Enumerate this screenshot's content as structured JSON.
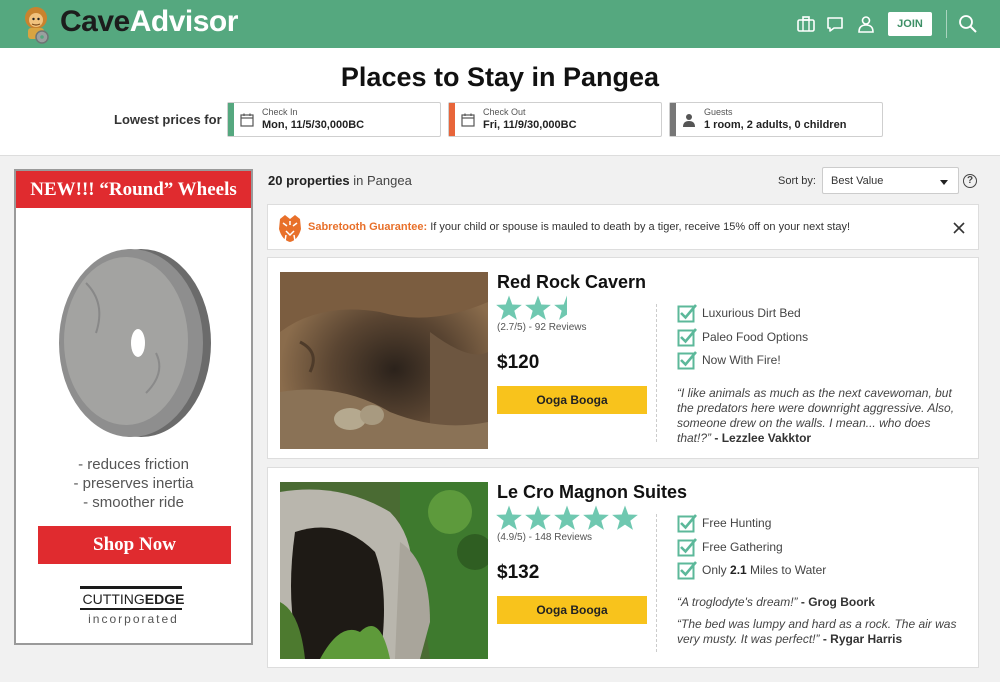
{
  "header": {
    "brand_part1": "Cave",
    "brand_part2": "Advisor",
    "join_label": "JOIN",
    "icons": [
      "luggage-icon",
      "chat-icon",
      "user-icon",
      "search-icon"
    ]
  },
  "hero": {
    "title": "Places to Stay in Pangea",
    "lowest_prices_label": "Lowest prices for",
    "check_in": {
      "label": "Check In",
      "value": "Mon, 11/5/30,000BC",
      "color": "#55a87f"
    },
    "check_out": {
      "label": "Check Out",
      "value": "Fri, 11/9/30,000BC",
      "color": "#e8653a"
    },
    "guests": {
      "label": "Guests",
      "value": "1 room, 2 adults, 0 children",
      "color": "#777777"
    }
  },
  "ad": {
    "headline": "NEW!!! “Round” Wheels",
    "bullets": [
      "- reduces friction",
      "- preserves inertia",
      "- smoother ride"
    ],
    "cta": "Shop Now",
    "brand_a": "CUTTING",
    "brand_b": "EDGE",
    "brand_sub": "incorporated"
  },
  "results": {
    "count": "20 properties",
    "location": " in Pangea",
    "sort_label": "Sort by:",
    "sort_value": "Best Value",
    "help": "?"
  },
  "guarantee": {
    "title": "Sabretooth Guarantee:",
    "text": " If your child or spouse is mauled to death by a tiger, receive 15% off on your next stay!"
  },
  "listings": [
    {
      "name": "Red Rock Cavern",
      "rating": 2.7,
      "rating_text": "(2.7/5) - 92 Reviews",
      "price": "$120",
      "cta": "Ooga Booga",
      "amenities": [
        "Luxurious Dirt Bed",
        "Paleo Food Options",
        "Now With Fire!"
      ],
      "reviews": [
        {
          "text": "“I like animals as much as the next cavewoman, but the predators here were downright aggressive. Also, someone drew on the walls. I mean... who does that!?”",
          "author": " - Lezzlee Vakktor"
        }
      ]
    },
    {
      "name": "Le Cro Magnon Suites",
      "rating": 4.9,
      "rating_text": "(4.9/5) - 148 Reviews",
      "price": "$132",
      "cta": "Ooga Booga",
      "amenities_pre": [
        "Free Hunting",
        "Free Gathering"
      ],
      "amenity3_pre": "Only ",
      "amenity3_bold": "2.1",
      "amenity3_post": " Miles to Water",
      "reviews": [
        {
          "text": "“A troglodyte's dream!”",
          "author": " - Grog Boork"
        },
        {
          "text": "“The bed was lumpy and hard as a rock. The air was very musty. It was perfect!”",
          "author": " - Rygar Harris"
        }
      ]
    }
  ],
  "colors": {
    "brand_green": "#55a87f",
    "accent_red": "#e02b2f",
    "star_teal": "#6fc8b0",
    "cta_yellow": "#f8c31c",
    "guarantee_orange": "#e8702a"
  }
}
